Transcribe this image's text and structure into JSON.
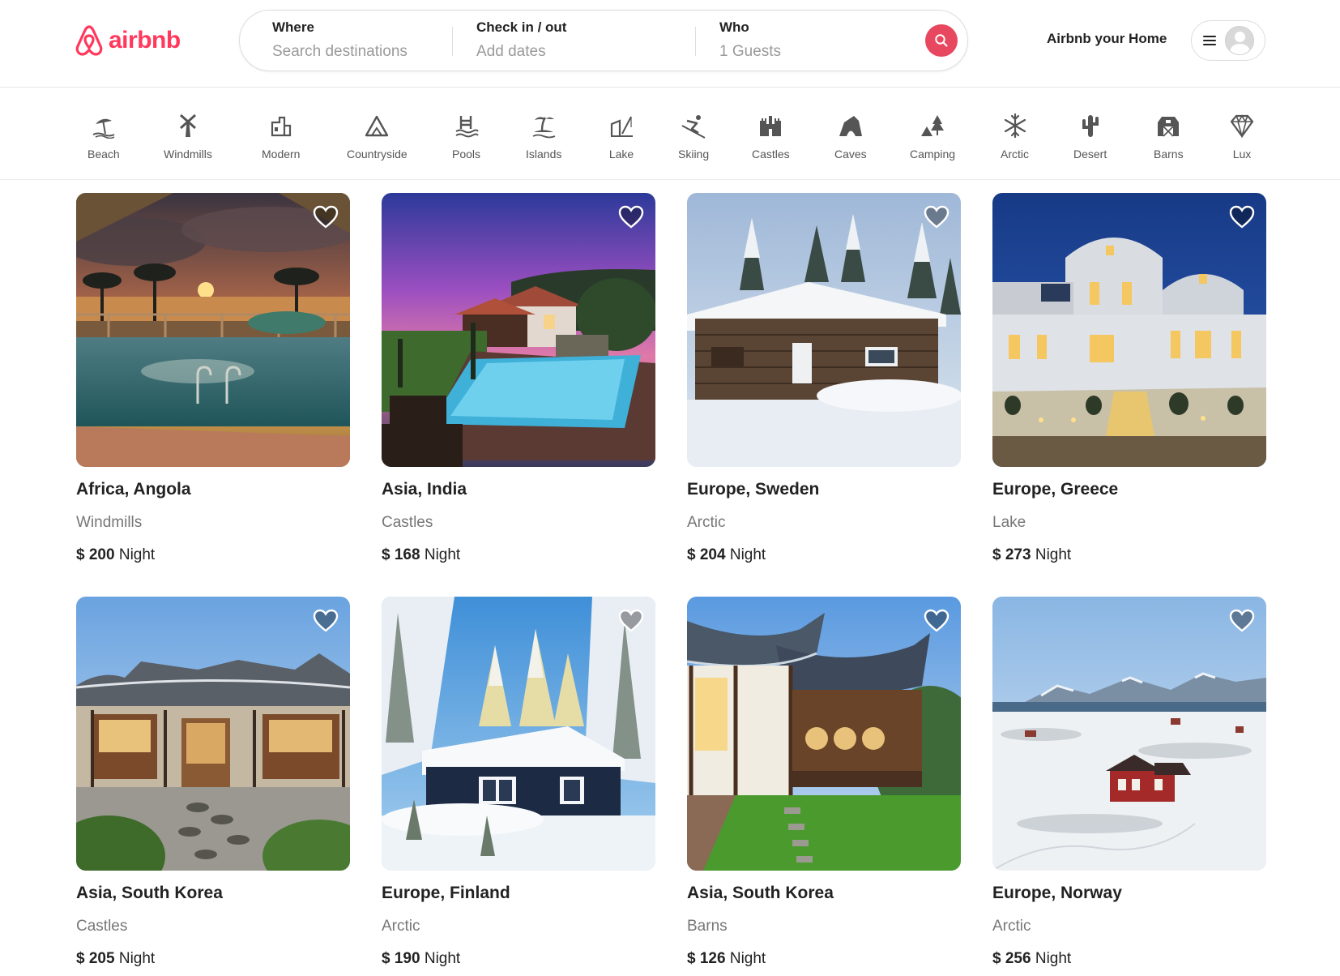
{
  "brand": {
    "name": "airbnb",
    "color": "#ff385c"
  },
  "search": {
    "where_label": "Where",
    "where_placeholder": "Search destinations",
    "check_label": "Check in / out",
    "check_placeholder": "Add dates",
    "who_label": "Who",
    "who_value": "1 Guests",
    "button_icon": "search-icon",
    "button_color": "#e8485f"
  },
  "header": {
    "host_link": "Airbnb your Home",
    "menu_icon": "hamburger-icon",
    "avatar_icon": "user-avatar-icon"
  },
  "categories": [
    {
      "label": "Beach",
      "icon": "beach-icon"
    },
    {
      "label": "Windmills",
      "icon": "windmill-icon"
    },
    {
      "label": "Modern",
      "icon": "modern-house-icon"
    },
    {
      "label": "Countryside",
      "icon": "countryside-icon"
    },
    {
      "label": "Pools",
      "icon": "pool-icon"
    },
    {
      "label": "Islands",
      "icon": "island-icon"
    },
    {
      "label": "Lake",
      "icon": "lake-icon"
    },
    {
      "label": "Skiing",
      "icon": "skiing-icon"
    },
    {
      "label": "Castles",
      "icon": "castle-icon"
    },
    {
      "label": "Caves",
      "icon": "cave-icon"
    },
    {
      "label": "Camping",
      "icon": "camping-icon"
    },
    {
      "label": "Arctic",
      "icon": "snowflake-icon"
    },
    {
      "label": "Desert",
      "icon": "cactus-icon"
    },
    {
      "label": "Barns",
      "icon": "barn-icon"
    },
    {
      "label": "Lux",
      "icon": "diamond-icon"
    }
  ],
  "listings": [
    {
      "location": "Africa, Angola",
      "category": "Windmills",
      "currency": "$",
      "price": "200",
      "unit": "Night",
      "photo": "sunset-pool-resort"
    },
    {
      "location": "Asia, India",
      "category": "Castles",
      "currency": "$",
      "price": "168",
      "unit": "Night",
      "photo": "villa-pool-dusk"
    },
    {
      "location": "Europe, Sweden",
      "category": "Arctic",
      "currency": "$",
      "price": "204",
      "unit": "Night",
      "photo": "snowy-log-cabin"
    },
    {
      "location": "Europe, Greece",
      "category": "Lake",
      "currency": "$",
      "price": "273",
      "unit": "Night",
      "photo": "white-cycladic-house-night"
    },
    {
      "location": "Asia, South Korea",
      "category": "Castles",
      "currency": "$",
      "price": "205",
      "unit": "Night",
      "photo": "hanok-house"
    },
    {
      "location": "Europe, Finland",
      "category": "Arctic",
      "currency": "$",
      "price": "190",
      "unit": "Night",
      "photo": "snow-covered-cottage"
    },
    {
      "location": "Asia, South Korea",
      "category": "Barns",
      "currency": "$",
      "price": "126",
      "unit": "Night",
      "photo": "hanok-lawn"
    },
    {
      "location": "Europe, Norway",
      "category": "Arctic",
      "currency": "$",
      "price": "256",
      "unit": "Night",
      "photo": "red-house-snow-fjord"
    }
  ]
}
